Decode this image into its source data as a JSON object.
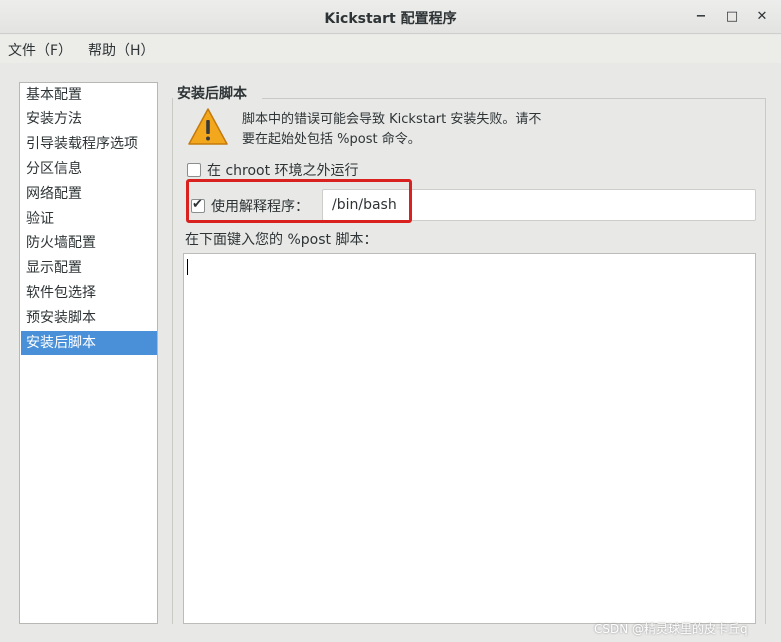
{
  "window": {
    "title": "Kickstart 配置程序",
    "minimize": "−",
    "maximize": "□",
    "close": "✕"
  },
  "menu": {
    "file": "文件（F）",
    "help": "帮助（H）"
  },
  "sidebar": {
    "items": [
      {
        "label": "基本配置"
      },
      {
        "label": "安装方法"
      },
      {
        "label": "引导装载程序选项"
      },
      {
        "label": "分区信息"
      },
      {
        "label": "网络配置"
      },
      {
        "label": "验证"
      },
      {
        "label": "防火墙配置"
      },
      {
        "label": "显示配置"
      },
      {
        "label": "软件包选择"
      },
      {
        "label": "预安装脚本"
      },
      {
        "label": "安装后脚本"
      }
    ],
    "selected": "安装后脚本"
  },
  "main": {
    "section_title": "安装后脚本",
    "warning_icon": "warning-icon",
    "warning_line1": "脚本中的错误可能会导致 Kickstart 安装失败。请不",
    "warning_line2": "要在起始处包括 %post 命令。",
    "chroot_label": "在 chroot 环境之外运行",
    "chroot_checked": false,
    "interpreter_label": "使用解释程序：",
    "interpreter_checked": true,
    "interpreter_value": "/bin/bash",
    "script_label": "在下面键入您的 %post 脚本：",
    "script_value": ""
  },
  "colors": {
    "highlight": "#d9211f",
    "selection": "#4a90d9",
    "warning": "#f2a71d"
  },
  "watermark": "CSDN @精灵球里的皮卡丘q"
}
